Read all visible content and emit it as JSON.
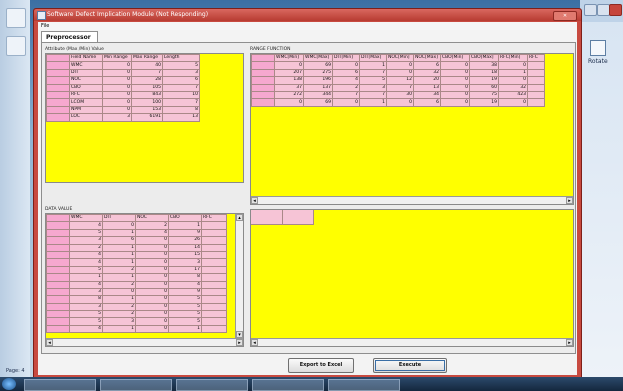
{
  "window": {
    "title": "Software Defect Implication Module (Not Responding)",
    "close_label": "✕"
  },
  "menu": {
    "file": "File"
  },
  "tabs": [
    {
      "label": "Preprocessor"
    }
  ],
  "right_ribbon": {
    "rotate_label": "Rotate"
  },
  "taskbar": {
    "page_label": "Page: 4"
  },
  "attribute_panel": {
    "title": "Attribute (Max /Min) Value",
    "columns": [
      "Field Name",
      "Min Range",
      "Max Range",
      "Length"
    ],
    "rows": [
      [
        "WMC",
        "0",
        "40",
        "5"
      ],
      [
        "DIT",
        "0",
        "7",
        "3"
      ],
      [
        "NOC",
        "0",
        "28",
        "6"
      ],
      [
        "CBO",
        "0",
        "105",
        "7"
      ],
      [
        "RFC",
        "0",
        "843",
        "10"
      ],
      [
        "LCOM",
        "0",
        "100",
        "7"
      ],
      [
        "NPM",
        "0",
        "153",
        "8"
      ],
      [
        "LOC",
        "3",
        "6191",
        "13"
      ]
    ]
  },
  "range_panel": {
    "title": "RANGE FUNCTION",
    "columns": [
      "WMC[Min]",
      "WMC[Max]",
      "DIT[Min]",
      "DIT[Max]",
      "NOC[Min]",
      "NOC[Max]",
      "CBO[Min]",
      "CBO[Max]",
      "RFC[Min]",
      "RFC"
    ],
    "rows": [
      [
        "0",
        "69",
        "0",
        "1",
        "0",
        "6",
        "0",
        "38",
        "0",
        ""
      ],
      [
        "207",
        "275",
        "6",
        "7",
        "0",
        "32",
        "0",
        "18",
        "1",
        ""
      ],
      [
        "138",
        "196",
        "4",
        "5",
        "12",
        "20",
        "0",
        "19",
        "0",
        ""
      ],
      [
        "37",
        "137",
        "2",
        "3",
        "7",
        "13",
        "0",
        "60",
        "32",
        ""
      ],
      [
        "272",
        "344",
        "7",
        "7",
        "30",
        "34",
        "0",
        "75",
        "423",
        ""
      ],
      [
        "0",
        "69",
        "0",
        "1",
        "0",
        "6",
        "0",
        "19",
        "0",
        ""
      ]
    ]
  },
  "data_panel": {
    "title": "DATA VALUE",
    "columns": [
      "WMC",
      "DIT",
      "NOC",
      "CBO",
      "RFC"
    ],
    "rows": [
      [
        "4",
        "0",
        "2",
        "1",
        ""
      ],
      [
        "5",
        "1",
        "4",
        "9",
        ""
      ],
      [
        "3",
        "6",
        "0",
        "26",
        ""
      ],
      [
        "2",
        "1",
        "0",
        "14",
        ""
      ],
      [
        "4",
        "1",
        "0",
        "15",
        ""
      ],
      [
        "4",
        "1",
        "0",
        "3",
        ""
      ],
      [
        "5",
        "2",
        "0",
        "17",
        ""
      ],
      [
        "1",
        "1",
        "0",
        "8",
        ""
      ],
      [
        "4",
        "2",
        "0",
        "4",
        ""
      ],
      [
        "3",
        "0",
        "0",
        "9",
        ""
      ],
      [
        "8",
        "1",
        "0",
        "5",
        ""
      ],
      [
        "3",
        "2",
        "0",
        "5",
        ""
      ],
      [
        "5",
        "2",
        "0",
        "5",
        ""
      ],
      [
        "5",
        "3",
        "0",
        "5",
        ""
      ],
      [
        "4",
        "1",
        "0",
        "1",
        ""
      ]
    ]
  },
  "buttons": {
    "export": "Export to Excel",
    "execute": "Execute"
  }
}
